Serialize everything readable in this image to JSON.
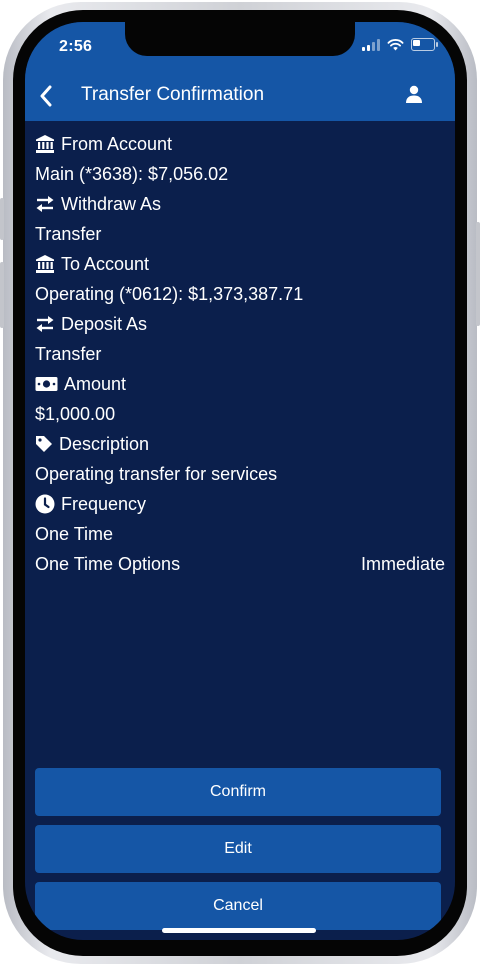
{
  "status_bar": {
    "time": "2:56"
  },
  "header": {
    "title": "Transfer Confirmation"
  },
  "details": {
    "from_account_label": "From Account",
    "from_account_value": "Main (*3638): $7,056.02",
    "withdraw_as_label": "Withdraw As",
    "withdraw_as_value": "Transfer",
    "to_account_label": "To Account",
    "to_account_value": "Operating (*0612): $1,373,387.71",
    "deposit_as_label": "Deposit As",
    "deposit_as_value": "Transfer",
    "amount_label": "Amount",
    "amount_value": "$1,000.00",
    "description_label": "Description",
    "description_value": "Operating transfer for services",
    "frequency_label": "Frequency",
    "frequency_value": "One Time",
    "options_label": "One Time Options",
    "options_value": "Immediate"
  },
  "actions": {
    "confirm": "Confirm",
    "edit": "Edit",
    "cancel": "Cancel"
  },
  "icons": {
    "back": "chevron-left-icon",
    "user": "user-icon",
    "bank": "bank-icon",
    "swap": "swap-arrows-icon",
    "money": "money-bill-icon",
    "tag": "tag-icon",
    "clock": "clock-icon"
  },
  "colors": {
    "header_blue": "#1556a6",
    "background_navy": "#0b1f4c",
    "button_blue": "#1556a6"
  }
}
